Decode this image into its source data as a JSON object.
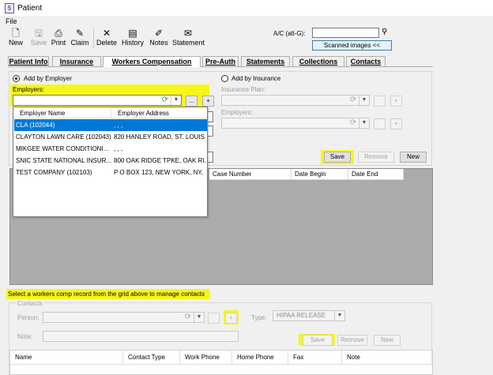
{
  "window": {
    "title": "Patient",
    "icon": "app-icon"
  },
  "menu": {
    "file": "File"
  },
  "toolbar": {
    "new": "New",
    "save": "Save",
    "print": "Print",
    "claim": "Claim",
    "delete": "Delete",
    "history": "History",
    "notes": "Notes",
    "statement": "Statement",
    "ac_label": "A/C (alt-G):",
    "ac_value": "",
    "scanned": "Scanned images <<"
  },
  "tabs": [
    "Patient Info",
    "Insurance",
    "Workers Compensation",
    "Pre-Auth",
    "Statements",
    "Collections",
    "Contacts"
  ],
  "form": {
    "add_by_employer": "Add by Employer",
    "add_by_insurance": "Add by Insurance",
    "employers_label": "Employers:",
    "employer_value": "",
    "insurance_plan_label": "Insurance Plan:",
    "employers_right_label": "Employers:",
    "ellipsis": "...",
    "plus": "+",
    "save": "Save",
    "remove": "Remove",
    "new": "New"
  },
  "employer_dropdown": {
    "headers": [
      "Employer Name",
      "Employer Address"
    ],
    "rows": [
      {
        "name": "CLA (102044)",
        "address": ", , ,"
      },
      {
        "name": "CLAYTON LAWN CARE (102043)",
        "address": "820 HANLEY ROAD, ST. LOUIS..."
      },
      {
        "name": "MIKGEE WATER CONDITIONI...",
        "address": ", , ,"
      },
      {
        "name": "SNIC STATE NATIONAL INSUR...",
        "address": "800 OAK RIDGE TPKE, OAK RI..."
      },
      {
        "name": "TEST COMPANY (102103)",
        "address": "P O BOX 123, NEW YORK, NY, ..."
      }
    ]
  },
  "case_grid": {
    "headers": [
      "Case Number",
      "Date Begin",
      "Date End"
    ]
  },
  "contacts": {
    "message": "Select a workers comp record from the grid above to manage contacts",
    "group_title": "Contacts",
    "person_label": "Person:",
    "type_label": "Type:",
    "type_value": "HIPAA RELEASE",
    "note_label": "Note:",
    "save": "Save",
    "remove": "Remove",
    "new": "New",
    "headers": [
      "Name",
      "Contact Type",
      "Work Phone",
      "Home Phone",
      "Fax",
      "Note"
    ]
  },
  "colors": {
    "highlight": "#f6f61a",
    "selected_row": "#0078d7"
  }
}
